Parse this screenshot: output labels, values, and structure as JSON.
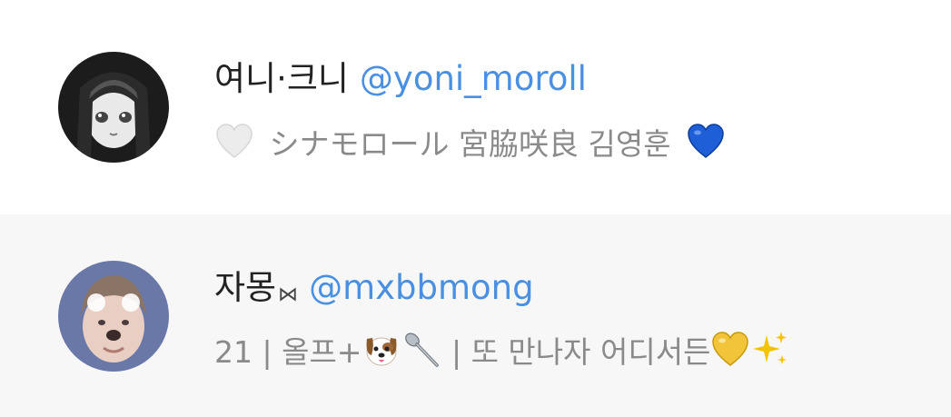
{
  "users": [
    {
      "display_name": "여니·크니",
      "handle": "@yoni_moroll",
      "bio": {
        "leading_icon": "white-heart-icon",
        "text": "シナモロール 宮脇咲良 김영훈",
        "trailing_icon": "blue-heart-icon"
      },
      "colors": {
        "heart_blue": "#1e5fd8",
        "heart_white": "#e8e8e8"
      }
    },
    {
      "display_name": "자몽",
      "name_decoration": "⋈",
      "handle": "@mxbbmong",
      "bio": {
        "part1": "21 | 올프+",
        "icons_a": [
          "dog-face-icon",
          "spoon-icon"
        ],
        "part2": " | 또 만나자 어디서든",
        "icons_b": [
          "yellow-heart-icon",
          "sparkles-icon"
        ]
      },
      "colors": {
        "heart_yellow": "#f2c43a",
        "sparkles": "#f5c400"
      }
    }
  ],
  "colors": {
    "handle_blue": "#4a90e2",
    "name_text": "#222222",
    "bio_text": "#8a8a8a",
    "row_alt_bg": "#f7f7f7"
  }
}
